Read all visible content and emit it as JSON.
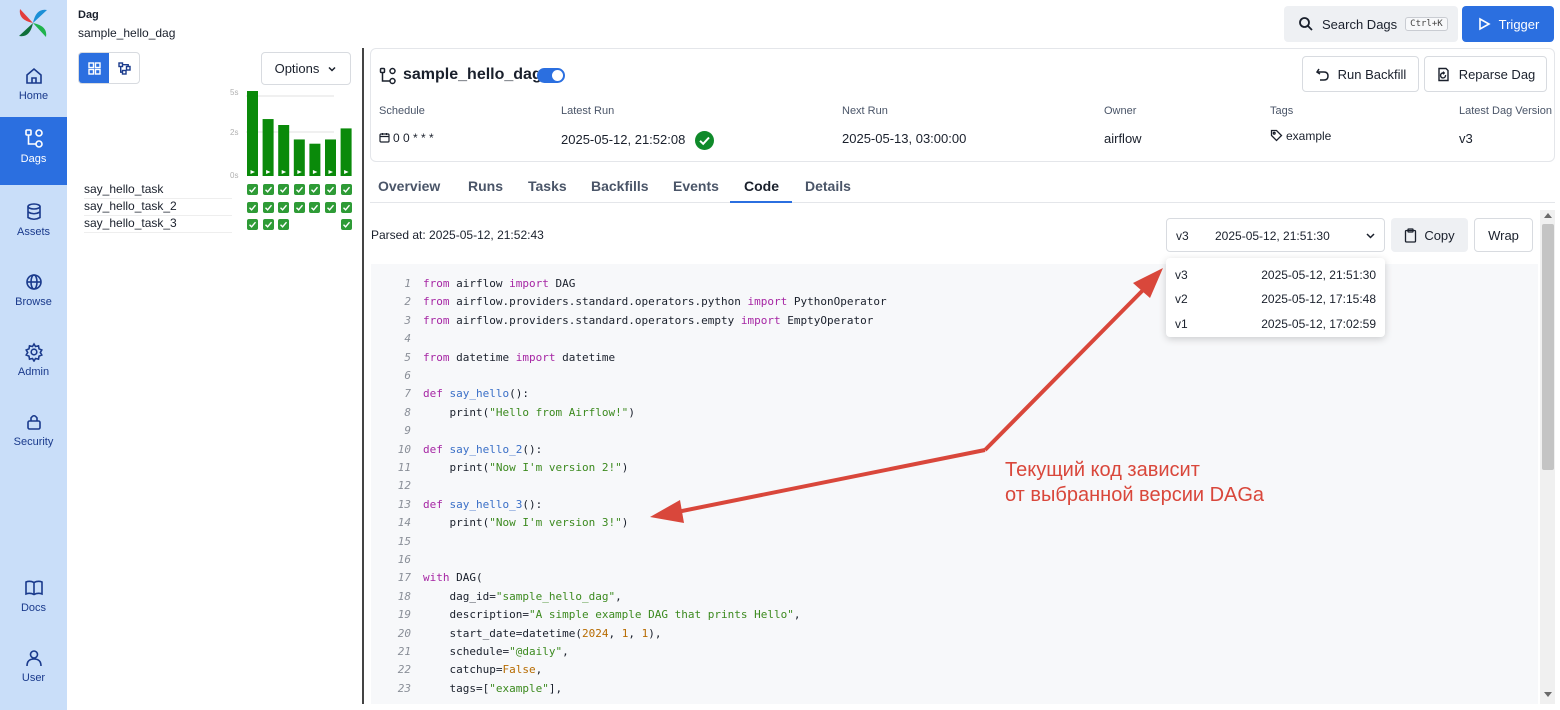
{
  "nav": {
    "items": [
      {
        "label": "Home",
        "icon": "home-icon"
      },
      {
        "label": "Dags",
        "icon": "dags-icon",
        "active": true
      },
      {
        "label": "Assets",
        "icon": "database-icon"
      },
      {
        "label": "Browse",
        "icon": "globe-icon"
      },
      {
        "label": "Admin",
        "icon": "gear-icon"
      },
      {
        "label": "Security",
        "icon": "lock-icon"
      },
      {
        "label": "Docs",
        "icon": "book-icon"
      },
      {
        "label": "User",
        "icon": "user-icon"
      }
    ]
  },
  "header": {
    "label": "Dag",
    "dag_name": "sample_hello_dag",
    "search_label": "Search Dags",
    "search_shortcut": "Ctrl+K",
    "trigger_label": "Trigger"
  },
  "grid_panel": {
    "options_label": "Options",
    "axis_ticks": [
      "5s",
      "2s",
      "0s"
    ],
    "run_bars": [
      1.0,
      0.67,
      0.6,
      0.43,
      0.38,
      0.43,
      0.56
    ],
    "tasks": [
      {
        "name": "say_hello_task",
        "states": [
          "success",
          "success",
          "success",
          "success",
          "success",
          "success",
          "success"
        ]
      },
      {
        "name": "say_hello_task_2",
        "states": [
          "success",
          "success",
          "success",
          "success",
          "success",
          "success",
          "success"
        ]
      },
      {
        "name": "say_hello_task_3",
        "states": [
          "success",
          "success",
          "success",
          "none",
          "none",
          "none",
          "success"
        ]
      }
    ]
  },
  "dag": {
    "title": "sample_hello_dag",
    "run_backfill_label": "Run Backfill",
    "reparse_label": "Reparse Dag",
    "meta": {
      "schedule_label": "Schedule",
      "schedule_value": "0 0 * * *",
      "latest_run_label": "Latest Run",
      "latest_run_value": "2025-05-12, 21:52:08",
      "next_run_label": "Next Run",
      "next_run_value": "2025-05-13, 03:00:00",
      "owner_label": "Owner",
      "owner_value": "airflow",
      "tags_label": "Tags",
      "tags_value": "example",
      "version_label": "Latest Dag Version",
      "version_value": "v3"
    }
  },
  "tabs": [
    "Overview",
    "Runs",
    "Tasks",
    "Backfills",
    "Events",
    "Code",
    "Details"
  ],
  "active_tab": "Code",
  "code_toolbar": {
    "parsed_at": "Parsed at: 2025-05-12, 21:52:43",
    "selected_version": "v3",
    "selected_date": "2025-05-12, 21:51:30",
    "copy_label": "Copy",
    "wrap_label": "Wrap"
  },
  "version_options": [
    {
      "version": "v3",
      "date": "2025-05-12, 21:51:30"
    },
    {
      "version": "v2",
      "date": "2025-05-12, 17:15:48"
    },
    {
      "version": "v1",
      "date": "2025-05-12, 17:02:59"
    }
  ],
  "code_lines": [
    {
      "n": "1",
      "html": "<span class=\"kw\">from</span> airflow <span class=\"kw\">import</span> DAG"
    },
    {
      "n": "2",
      "html": "<span class=\"kw\">from</span> airflow.providers.standard.operators.python <span class=\"kw\">import</span> PythonOperator"
    },
    {
      "n": "3",
      "html": "<span class=\"kw\">from</span> airflow.providers.standard.operators.empty <span class=\"kw\">import</span> EmptyOperator"
    },
    {
      "n": "4",
      "html": ""
    },
    {
      "n": "5",
      "html": "<span class=\"kw\">from</span> datetime <span class=\"kw\">import</span> datetime"
    },
    {
      "n": "6",
      "html": ""
    },
    {
      "n": "7",
      "html": "<span class=\"kw\">def</span> <span class=\"fn\">say_hello</span>():"
    },
    {
      "n": "8",
      "html": "    print(<span class=\"str\">\"Hello from Airflow!\"</span>)"
    },
    {
      "n": "9",
      "html": ""
    },
    {
      "n": "10",
      "html": "<span class=\"kw\">def</span> <span class=\"fn\">say_hello_2</span>():"
    },
    {
      "n": "11",
      "html": "    print(<span class=\"str\">\"Now I'm version 2!\"</span>)"
    },
    {
      "n": "12",
      "html": ""
    },
    {
      "n": "13",
      "html": "<span class=\"kw\">def</span> <span class=\"fn\">say_hello_3</span>():"
    },
    {
      "n": "14",
      "html": "    print(<span class=\"str\">\"Now I'm version 3!\"</span>)"
    },
    {
      "n": "15",
      "html": ""
    },
    {
      "n": "16",
      "html": ""
    },
    {
      "n": "17",
      "html": "<span class=\"kw\">with</span> DAG("
    },
    {
      "n": "18",
      "html": "    dag_id=<span class=\"str\">\"sample_hello_dag\"</span>,"
    },
    {
      "n": "19",
      "html": "    description=<span class=\"str\">\"A simple example DAG that prints Hello\"</span>,"
    },
    {
      "n": "20",
      "html": "    start_date=datetime(<span class=\"num\">2024</span>, <span class=\"num\">1</span>, <span class=\"num\">1</span>),"
    },
    {
      "n": "21",
      "html": "    schedule=<span class=\"str\">\"@daily\"</span>,"
    },
    {
      "n": "22",
      "html": "    catchup=<span class=\"num\">False</span>,"
    },
    {
      "n": "23",
      "html": "    tags=[<span class=\"str\">\"example\"</span>],"
    }
  ],
  "annotation": {
    "line1": "Текущий код зависит",
    "line2": "от выбранной версии DAGa",
    "color": "#d9473b"
  },
  "colors": {
    "accent": "#2b6fe0",
    "nav_bg": "#c9def9",
    "success": "#2e9b36",
    "bar": "#0a8a0a"
  }
}
